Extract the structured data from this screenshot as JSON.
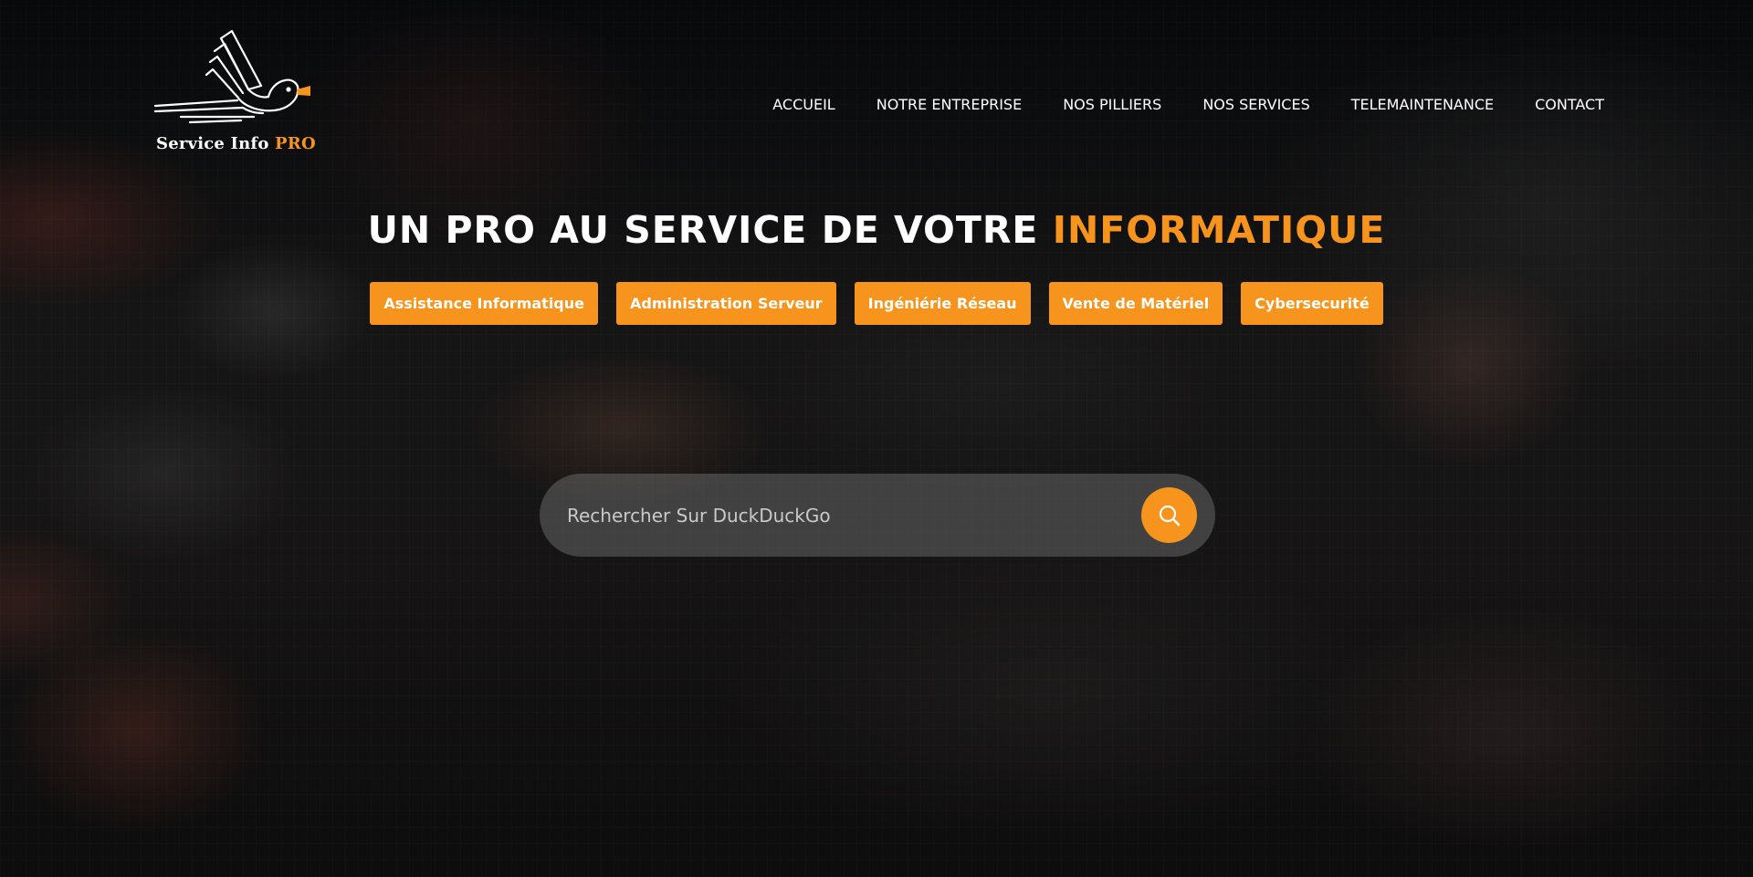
{
  "brand": {
    "name": "Service Info",
    "name_accent": "PRO"
  },
  "nav": {
    "items": [
      {
        "label": "ACCUEIL"
      },
      {
        "label": "NOTRE ENTREPRISE"
      },
      {
        "label": "NOS PILLIERS"
      },
      {
        "label": "NOS SERVICES"
      },
      {
        "label": "TELEMAINTENANCE"
      },
      {
        "label": "CONTACT"
      }
    ]
  },
  "hero": {
    "title": "UN PRO AU SERVICE DE VOTRE",
    "title_accent": "INFORMATIQUE"
  },
  "services": [
    {
      "label": "Assistance Informatique"
    },
    {
      "label": "Administration Serveur"
    },
    {
      "label": "Ingéniérie Réseau"
    },
    {
      "label": "Vente de Matériel"
    },
    {
      "label": "Cybersecurité"
    }
  ],
  "search": {
    "placeholder": "Rechercher Sur DuckDuckGo",
    "value": "",
    "button_icon": "search-icon"
  },
  "colors": {
    "accent": "#f7941d",
    "text": "#ffffff"
  }
}
